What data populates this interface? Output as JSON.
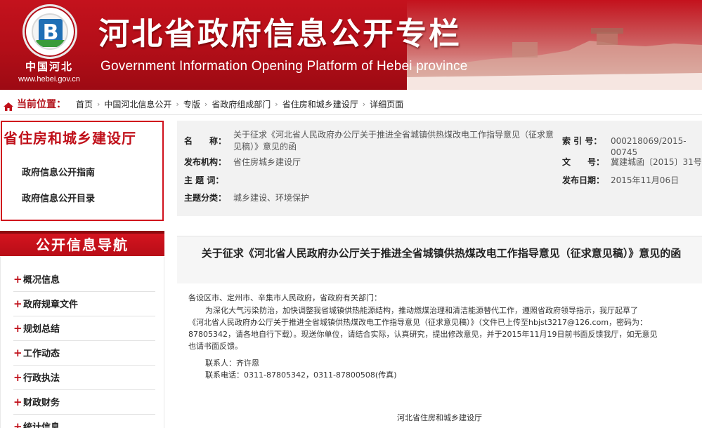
{
  "banner": {
    "logo_hebei": "中国河北",
    "logo_url": "www.hebei.gov.cn",
    "title": "河北省政府信息公开专栏",
    "subtitle": "Government Information Opening Platform of Hebei province"
  },
  "breadcrumb": {
    "label": "当前位置：",
    "items": [
      "首页",
      "中国河北信息公开",
      "专版",
      "省政府组成部门",
      "省住房和城乡建设厅",
      "详细页面"
    ],
    "separator": "›"
  },
  "dept": {
    "title": "省住房和城乡建设厅",
    "links": [
      "政府信息公开指南",
      "政府信息公开目录"
    ]
  },
  "nav": {
    "heading": "公开信息导航",
    "items": [
      "概况信息",
      "政府规章文件",
      "规划总结",
      "工作动态",
      "行政执法",
      "财政财务",
      "统计信息"
    ]
  },
  "meta": {
    "name_label": "名　　称：",
    "name_value_line1": "关于征求《河北省人民政府办公厅关于推进全省城镇供热煤改电工作指导意见（征求意",
    "name_value_line2": "见稿）》意见的函",
    "index_label": "索 引 号：",
    "index_value": "000218069/2015-00745",
    "org_label": "发布机构：",
    "org_value": "省住房城乡建设厅",
    "docno_label": "文　　号：",
    "docno_value": "冀建城函〔2015〕31号",
    "keywords_label": "主 题 词：",
    "keywords_value": "",
    "date_label": "发布日期：",
    "date_value": "2015年11月06日",
    "category_label": "主题分类：",
    "category_value": "城乡建设、环境保护"
  },
  "article": {
    "title": "关于征求《河北省人民政府办公厅关于推进全省城镇供热煤改电工作指导意见（征求意见稿）》意见的函",
    "salutation": "各设区市、定州市、辛集市人民政府，省政府有关部门：",
    "body_line1": "为深化大气污染防治，加快调整我省城镇供热能源结构，推动燃煤治理和清洁能源替代工作，遵照省政府领导指示，我厅起草了",
    "body_line2": "《河北省人民政府办公厅关于推进全省城镇供热煤改电工作指导意见（征求意见稿）》（文件已上传至hbjst3217@126.com，密码为：",
    "body_line3": "87805342，请各地自行下载）。现送你单位，请结合实际，认真研究，提出修改意见，并于2015年11月19日前书面反馈我厅，如无意见",
    "body_line4": "也请书面反馈。",
    "contact": "联系人：齐许恩",
    "phone": "联系电话：0311-87805342，0311-87800508(传真)",
    "signature": "河北省住房和城乡建设厅"
  },
  "colors": {
    "brand_red": "#c4121d",
    "accent_red": "#b3121b",
    "meta_bg": "#f2f2f2"
  }
}
